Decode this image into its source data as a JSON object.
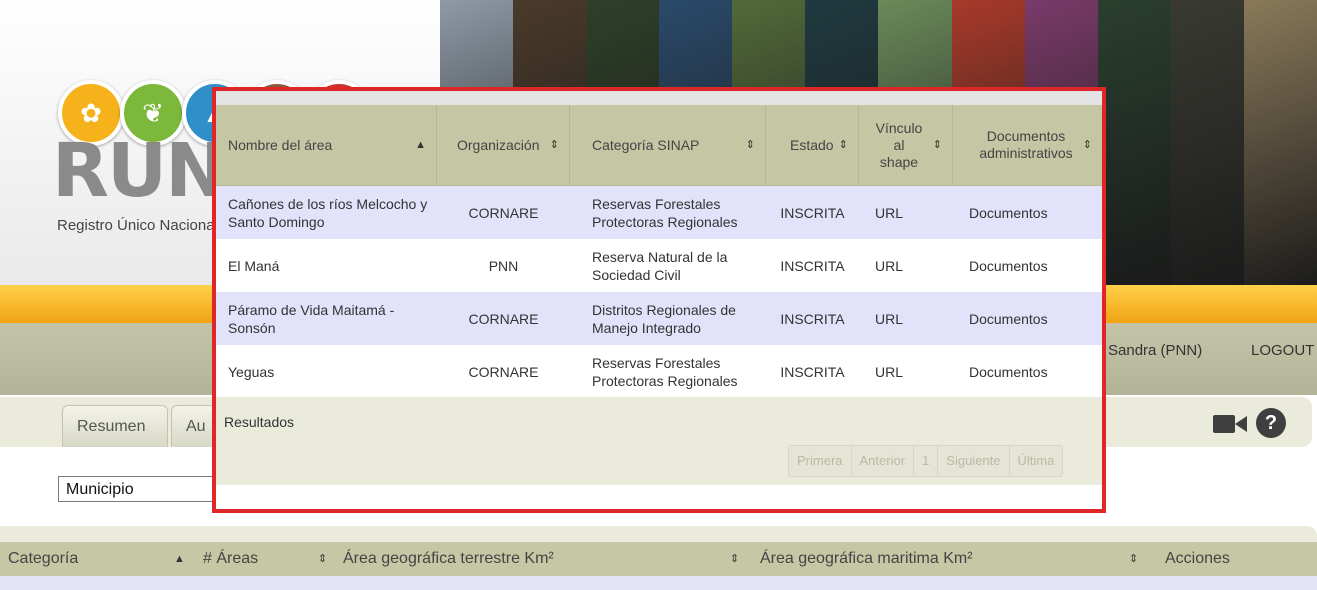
{
  "header": {
    "logo_text": "RUN",
    "logo_subtitle": "Registro Único Nacional de Áreas Protegidas",
    "photo_colors": [
      "#8f9aa6",
      "#4a3a2a",
      "#2f3f28",
      "#2a4a6a",
      "#526a3a",
      "#1f3a3f",
      "#6a8a5a",
      "#a83a2a",
      "#7a3a6a",
      "#2a3f2f",
      "#3a3a33",
      "#8a7a5a"
    ]
  },
  "nav": {
    "user": "Sandra (PNN)",
    "logout": "LOGOUT"
  },
  "tabs": [
    "Resumen",
    "Au"
  ],
  "filter": {
    "select_value": "Municipio"
  },
  "bottom_table": {
    "headers": [
      "Categoría",
      "# Áreas",
      "Área geográfica terrestre Km²",
      "Área geográfica maritima Km²",
      "Acciones"
    ]
  },
  "modal": {
    "columns": [
      "Nombre del área",
      "Organización",
      "Categoría SINAP",
      "Estado",
      "Vínculo al shape",
      "Documentos administrativos"
    ],
    "rows": [
      {
        "nombre": "Cañones de los ríos Melcocho y Santo Domingo",
        "organizacion": "CORNARE",
        "categoria": "Reservas Forestales Protectoras Regionales",
        "estado": "INSCRITA",
        "vinculo": "URL",
        "documentos": "Documentos"
      },
      {
        "nombre": "El Maná",
        "organizacion": "PNN",
        "categoria": "Reserva Natural de la Sociedad Civil",
        "estado": "INSCRITA",
        "vinculo": "URL",
        "documentos": "Documentos"
      },
      {
        "nombre": "Páramo de Vida Maitamá - Sonsón",
        "organizacion": "CORNARE",
        "categoria": "Distritos Regionales de Manejo Integrado",
        "estado": "INSCRITA",
        "vinculo": "URL",
        "documentos": "Documentos"
      },
      {
        "nombre": "Yeguas",
        "organizacion": "CORNARE",
        "categoria": "Reservas Forestales Protectoras Regionales",
        "estado": "INSCRITA",
        "vinculo": "URL",
        "documentos": "Documentos"
      }
    ],
    "results_label": "Resultados",
    "pager": {
      "first": "Primera",
      "prev": "Anterior",
      "page": "1",
      "next": "Siguiente",
      "last": "Última"
    }
  },
  "colors": {
    "highlight_border": "#e02727",
    "header_bg": "#c4c6a4",
    "row_alt": "#e2e3fb",
    "orange_bar": "#f1a314"
  }
}
